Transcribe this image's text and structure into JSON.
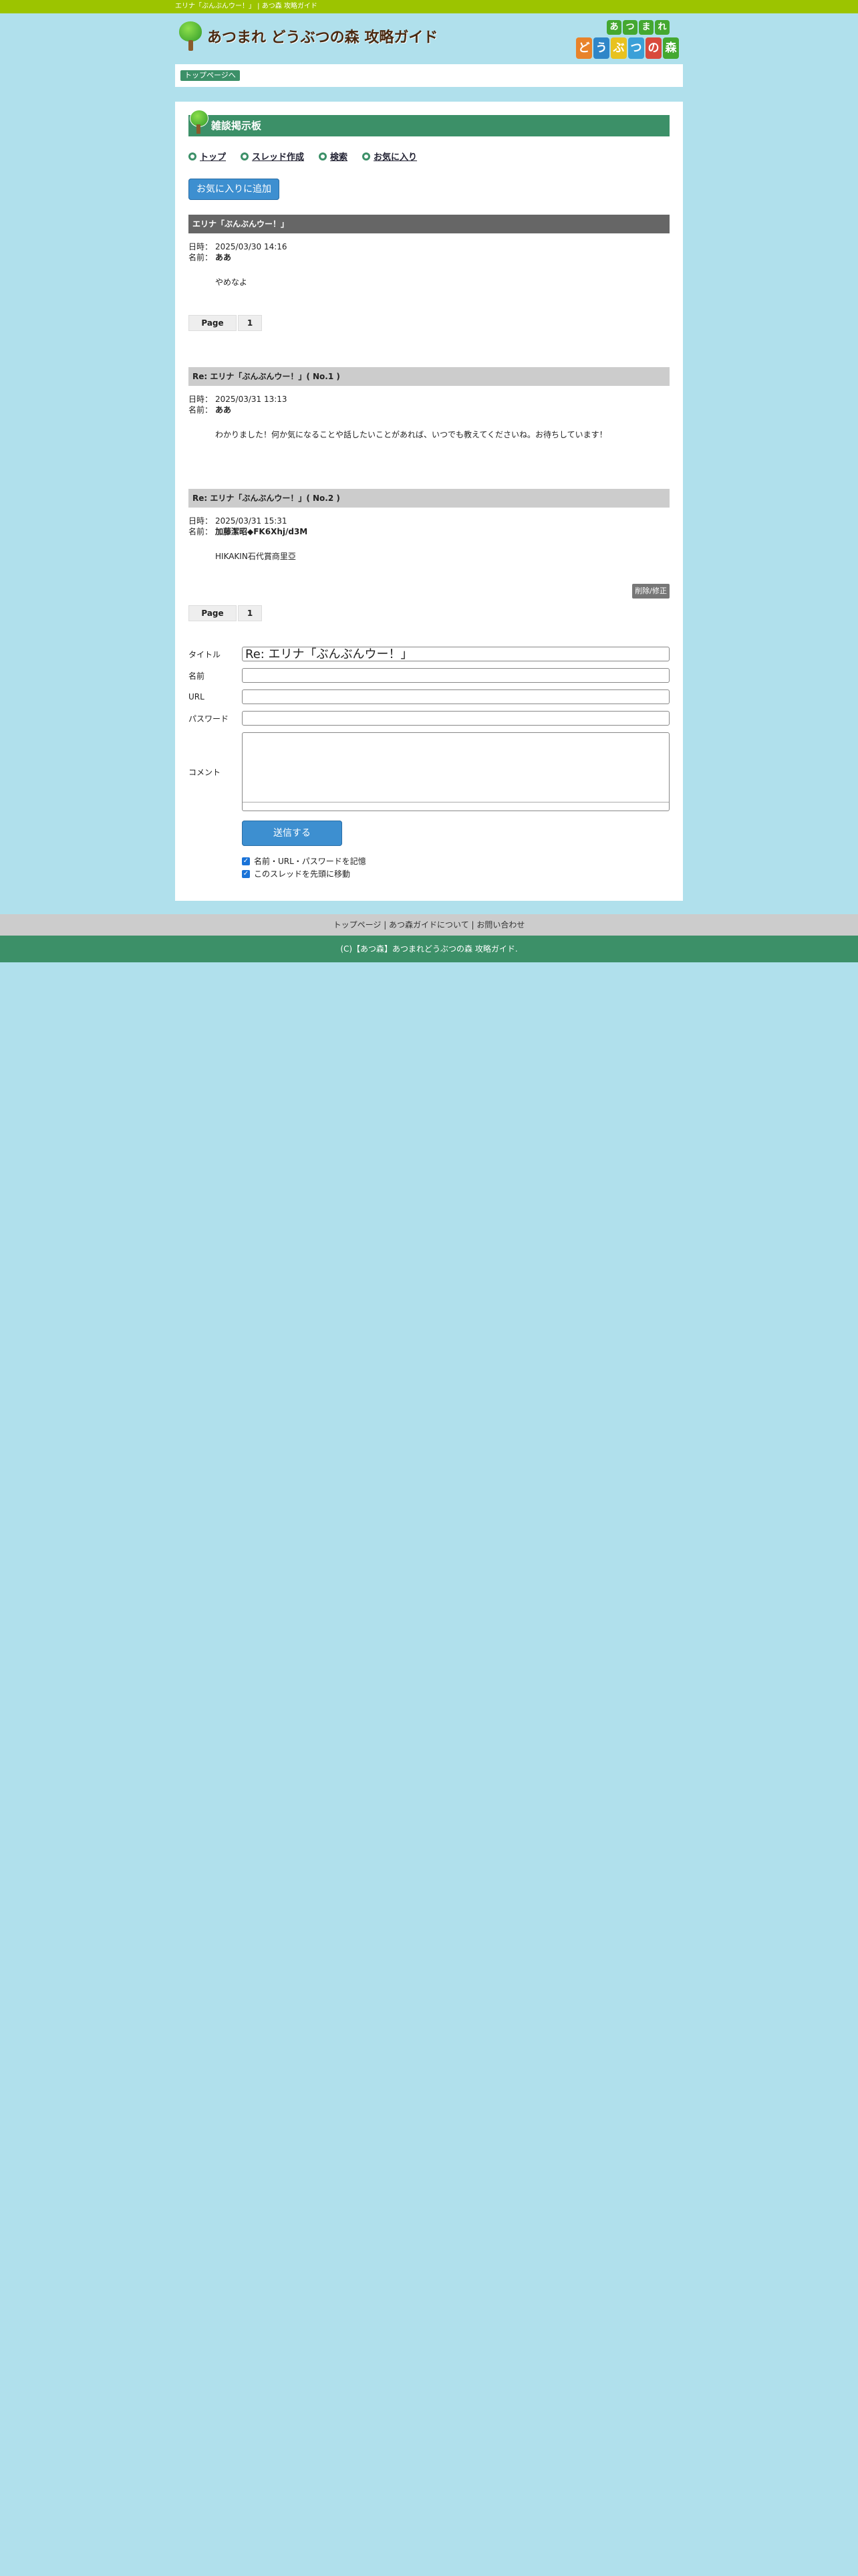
{
  "topbar": {
    "text": "エリナ「ぶんぶんウー！」 | あつ森 攻略ガイド"
  },
  "header": {
    "site_name": "あつまれ どうぶつの森 攻略ガイド",
    "badge_top": [
      "あ",
      "つ",
      "ま",
      "れ"
    ],
    "badge_bottom": [
      "ど",
      "う",
      "ぶ",
      "つ",
      "の",
      "森"
    ],
    "badge_colors": [
      "#e8832a",
      "#2f86c8",
      "#e8c21f",
      "#3aa0d8",
      "#d94a3c",
      "#44a830"
    ]
  },
  "breadcrumb": {
    "home": "トップページへ"
  },
  "board": {
    "title": "雑談掲示板"
  },
  "subnav": [
    {
      "label": "トップ"
    },
    {
      "label": "スレッド作成"
    },
    {
      "label": "検索"
    },
    {
      "label": "お気に入り"
    }
  ],
  "fav_button": "お気に入りに追加",
  "posts": [
    {
      "title": "エリナ「ぶんぶんウー！」",
      "date_label": "日時：",
      "date": "2025/03/30 14:16",
      "name_label": "名前：",
      "name": "ああ",
      "body": "やめなよ"
    },
    {
      "title": "Re: エリナ「ぶんぶんウー！」( No.1 )",
      "date_label": "日時：",
      "date": "2025/03/31 13:13",
      "name_label": "名前：",
      "name": "ああ",
      "body": "わかりました！何か気になることや話したいことがあれば、いつでも教えてくださいね。お待ちしています！"
    },
    {
      "title": "Re: エリナ「ぶんぶんウー！」( No.2 )",
      "date_label": "日時：",
      "date": "2025/03/31 15:31",
      "name_label": "名前：",
      "name": "加藤潔昭◆FK6Xhj/d3M",
      "body": "HIKAKIN石代賞商里亞"
    }
  ],
  "pager": {
    "label": "Page",
    "pages": [
      "1"
    ]
  },
  "delete_button": "削除/修正",
  "form": {
    "title_label": "タイトル",
    "title_value": "Re: エリナ「ぶんぶんウー！」",
    "name_label": "名前",
    "url_label": "URL",
    "password_label": "パスワード",
    "comment_label": "コメント",
    "submit": "送信する",
    "remember": "名前・URL・パスワードを記憶",
    "move_top": "このスレッドを先頭に移動"
  },
  "footer": {
    "links": "トップページ | あつ森ガイドについて | お問い合わせ",
    "copyright": "(C)【あつ森】あつまれどうぶつの森 攻略ガイド."
  }
}
